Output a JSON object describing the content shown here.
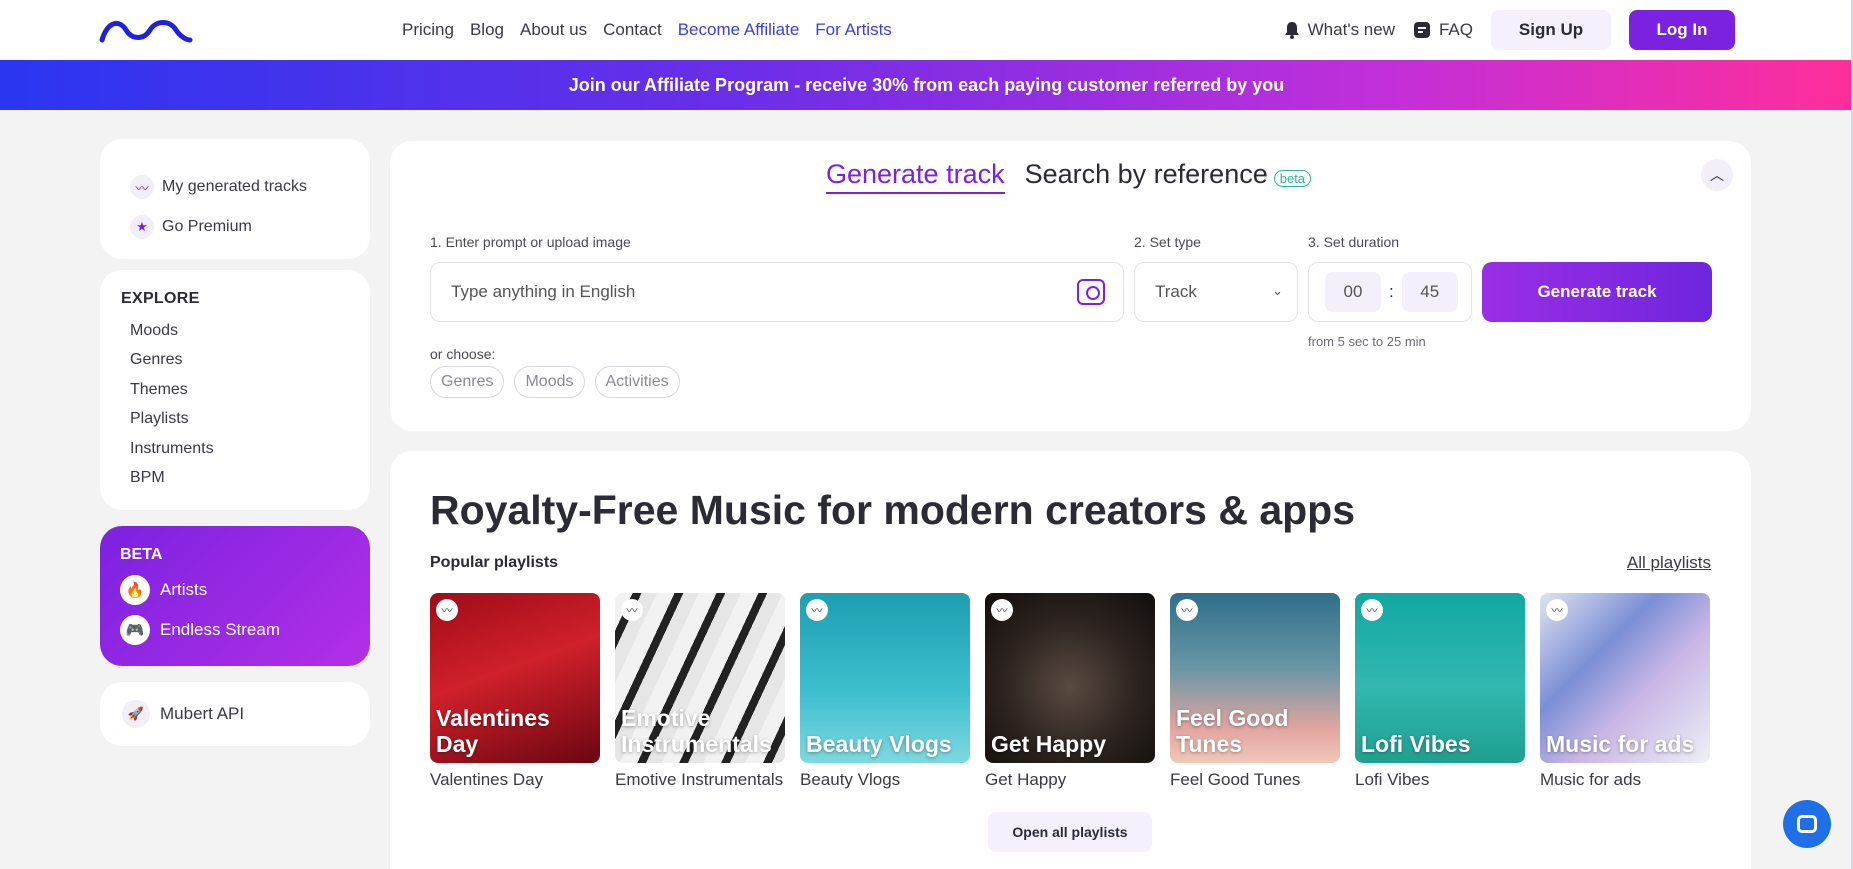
{
  "nav": {
    "links": [
      "Pricing",
      "Blog",
      "About us",
      "Contact",
      "Become Affiliate",
      "For Artists"
    ],
    "whats_new": "What's new",
    "faq": "FAQ",
    "sign_up": "Sign Up",
    "log_in": "Log In",
    "accent": "#7b22e0"
  },
  "banner": {
    "text": "Join our Affiliate Program - receive 30% from each paying customer referred by you"
  },
  "sidebar": {
    "top": [
      {
        "label": "My generated tracks",
        "icon": "waves-icon"
      },
      {
        "label": "Go Premium",
        "icon": "star-icon"
      }
    ],
    "explore_title": "EXPLORE",
    "explore": [
      "Moods",
      "Genres",
      "Themes",
      "Playlists",
      "Instruments",
      "BPM"
    ],
    "beta_title": "BETA",
    "beta": [
      {
        "label": "Artists",
        "icon": "fire-icon"
      },
      {
        "label": "Endless Stream",
        "icon": "gamepad-icon"
      }
    ],
    "api": {
      "label": "Mubert API",
      "icon": "rocket-icon"
    }
  },
  "generator": {
    "tab_active": "Generate track",
    "tab_other": "Search by reference",
    "tab_badge": "beta",
    "step1": "1. Enter prompt or upload image",
    "prompt_placeholder": "Type anything in English",
    "step2": "2. Set type",
    "type_value": "Track",
    "step3": "3. Set duration",
    "minutes": "00",
    "separator": ":",
    "seconds": "45",
    "duration_hint": "from 5 sec to 25 min",
    "generate_label": "Generate track",
    "or_choose": "or choose:",
    "chips": [
      "Genres",
      "Moods",
      "Activities"
    ]
  },
  "main": {
    "title": "Royalty-Free Music for modern creators & apps",
    "popular": "Popular playlists",
    "all_playlists": "All playlists",
    "open_all": "Open all playlists",
    "playlists": [
      {
        "title": "Valentines Day",
        "caption": "Valentines Day",
        "bg": "linear-gradient(160deg,#9e0c18 0%,#d0202a 45%,#6a0610 100%)"
      },
      {
        "title": "Emotive Instrumentals",
        "caption": "Emotive Instrumentals",
        "bg": "repeating-linear-gradient(115deg,#f2f2f2 0 16px,#222 16px 24px,#e6e6e6 24px 38px)"
      },
      {
        "title": "Beauty Vlogs",
        "caption": "Beauty Vlogs",
        "bg": "linear-gradient(180deg,#1d9fb2 0%,#3fc0cf 60%,#7fd8e0 100%)"
      },
      {
        "title": "Get Happy",
        "caption": "Get Happy",
        "bg": "radial-gradient(circle at 50% 55%,#5a4a40 0%,#2a221e 55%,#120e0c 100%)"
      },
      {
        "title": "Feel Good Tunes",
        "caption": "Feel Good Tunes",
        "bg": "linear-gradient(180deg,#2f6f8a 0%,#6a97a6 45%,#e2a5a0 80%,#f0c8b8 100%)"
      },
      {
        "title": "Lofi Vibes",
        "caption": "Lofi Vibes",
        "bg": "linear-gradient(180deg,#10a8a2 0%,#32b8b0 55%,#1f9f8f 100%)"
      },
      {
        "title": "Music for ads",
        "caption": "Music for ads",
        "bg": "linear-gradient(135deg,#dfe3f0 0%,#7b8fd6 35%,#c8b6e6 60%,#eef0f6 100%)"
      }
    ]
  }
}
